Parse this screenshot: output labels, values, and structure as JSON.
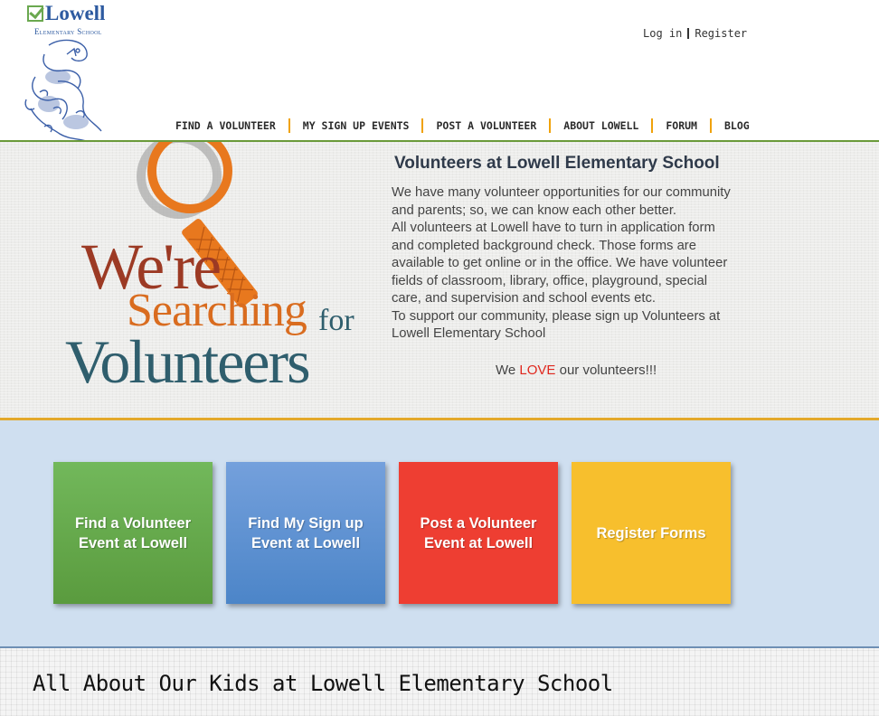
{
  "logo": {
    "name": "Lowell",
    "subtitle": "Elementary School"
  },
  "auth": {
    "login": "Log in",
    "register": "Register"
  },
  "nav": {
    "items": [
      "FIND A VOLUNTEER",
      "MY SIGN UP EVENTS",
      "POST A VOLUNTEER",
      "ABOUT LOWELL",
      "FORUM",
      "BLOG"
    ]
  },
  "hero": {
    "art": {
      "line1": "We're",
      "line2": "Searching",
      "line3": "for",
      "line4": "Volunteers"
    },
    "title": "Volunteers at Lowell Elementary School",
    "body_lines": [
      "We have many volunteer opportunities for our community",
      "and parents; so, we can know each other better.",
      "All volunteers at Lowell have to turn in application form",
      "and completed background check. Those forms are",
      "available to get online or in the office. We have volunteer",
      "fields of classroom, library, office, playground, special",
      "care, and supervision and school events etc.",
      "To support our community, please sign up Volunteers at",
      "Lowell Elementary School"
    ],
    "love_prefix": "We ",
    "love_word": "LOVE",
    "love_suffix": " our volunteers!!!"
  },
  "tiles": [
    {
      "label": "Find a Volunteer Event at Lowell",
      "color": "#5a9b3e"
    },
    {
      "label": "Find My Sign up Event at Lowell",
      "color": "#4c85c8"
    },
    {
      "label": "Post a Volunteer Event at Lowell",
      "color": "#ee3e32"
    },
    {
      "label": "Register Forms",
      "color": "#f7bf2d"
    }
  ],
  "bottom": {
    "title": "All About Our Kids at Lowell Elementary School"
  }
}
